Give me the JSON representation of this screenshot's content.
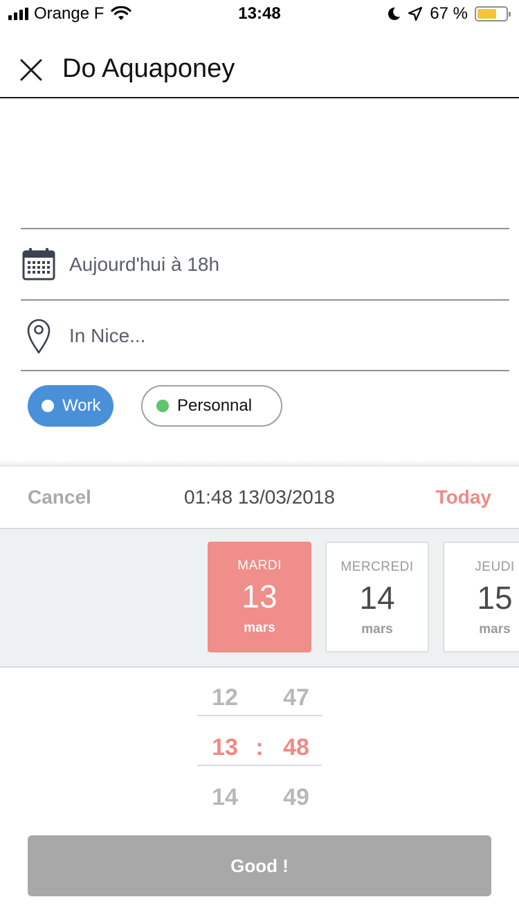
{
  "status_bar": {
    "carrier": "Orange F",
    "time": "13:48",
    "battery_percent": "67 %",
    "battery_level": 0.67,
    "battery_color": "#f5c633"
  },
  "header": {
    "title": "Do Aquaponey",
    "close_icon": "close-icon"
  },
  "form": {
    "date_value": "Aujourd'hui à 18h",
    "date_icon": "calendar-icon",
    "location_value": "In Nice...",
    "location_icon": "location-pin-icon"
  },
  "tags": [
    {
      "label": "Work",
      "selected": true,
      "color": "#4a90d9"
    },
    {
      "label": "Personnal",
      "selected": false,
      "color": "#5cc46a"
    }
  ],
  "picker": {
    "cancel_label": "Cancel",
    "selected_datetime": "01:48 13/03/2018",
    "today_label": "Today",
    "accent_color": "#ef8a86",
    "days": [
      {
        "name": "MARDI",
        "number": "13",
        "month": "mars",
        "selected": true
      },
      {
        "name": "MERCREDI",
        "number": "14",
        "month": "mars",
        "selected": false
      },
      {
        "name": "JEUDI",
        "number": "15",
        "month": "mars",
        "selected": false
      }
    ],
    "hours": {
      "prev": "12",
      "current": "13",
      "next": "14"
    },
    "minutes": {
      "prev": "47",
      "current": "48",
      "next": "49"
    },
    "separator": ":",
    "confirm_label": "Good !"
  }
}
